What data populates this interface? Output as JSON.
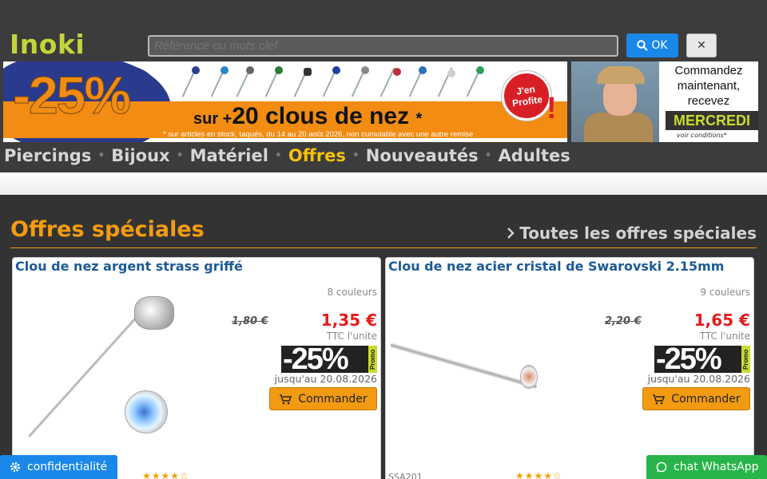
{
  "header": {
    "logo": "Inoki",
    "search_placeholder": "Référence ou mots clef",
    "ok_label": "OK",
    "close_label": "✕"
  },
  "promo_banner": {
    "discount": "-25%",
    "headline_prefix": "sur +",
    "headline": "20 clous de nez",
    "asterisk": "*",
    "fine_print": "* sur articles en stock, taqués, du 14 au 20 août 2026, non cumulable avec une autre remise",
    "cta_line1": "J'en",
    "cta_line2": "Profite"
  },
  "delivery_banner": {
    "text": "Commandez maintenant, recevez",
    "day": "MERCREDI",
    "note": "voir conditions*"
  },
  "nav": {
    "items": [
      {
        "label": "Piercings",
        "active": false
      },
      {
        "label": "Bijoux",
        "active": false
      },
      {
        "label": "Matériel",
        "active": false
      },
      {
        "label": "Offres",
        "active": true
      },
      {
        "label": "Nouveautés",
        "active": false
      },
      {
        "label": "Adultes",
        "active": false
      }
    ],
    "separator": "•"
  },
  "section": {
    "title": "Offres spéciales",
    "all_link": "Toutes les offres spéciales"
  },
  "products": [
    {
      "title": "Clou de nez argent strass griffé",
      "colors": "8 couleurs",
      "old_price": "1,80 €",
      "new_price": "1,35 €",
      "ttc": "TTC l'unite",
      "badge": "-25%",
      "badge_tag": "Promo",
      "until": "jusqu'au 20.08.2026",
      "order_label": "Commander",
      "ref": "",
      "stars": "★★★★☆"
    },
    {
      "title": "Clou de nez acier cristal de Swarovski 2.15mm",
      "colors": "9 couleurs",
      "old_price": "2,20 €",
      "new_price": "1,65 €",
      "ttc": "TTC l'unite",
      "badge": "-25%",
      "badge_tag": "Promo",
      "until": "jusqu'au 20.08.2026",
      "order_label": "Commander",
      "ref": "SSA201",
      "stars": "★★★★☆"
    }
  ],
  "footer": {
    "privacy_label": "confidentialité",
    "whatsapp_label": "chat WhatsApp"
  },
  "colors": {
    "accent_orange": "#f39c12",
    "logo_green": "#c4d43a",
    "link_blue": "#1c5a96",
    "price_red": "#e31c1c",
    "button_blue": "#1a88e8",
    "whatsapp_green": "#28b44a"
  }
}
